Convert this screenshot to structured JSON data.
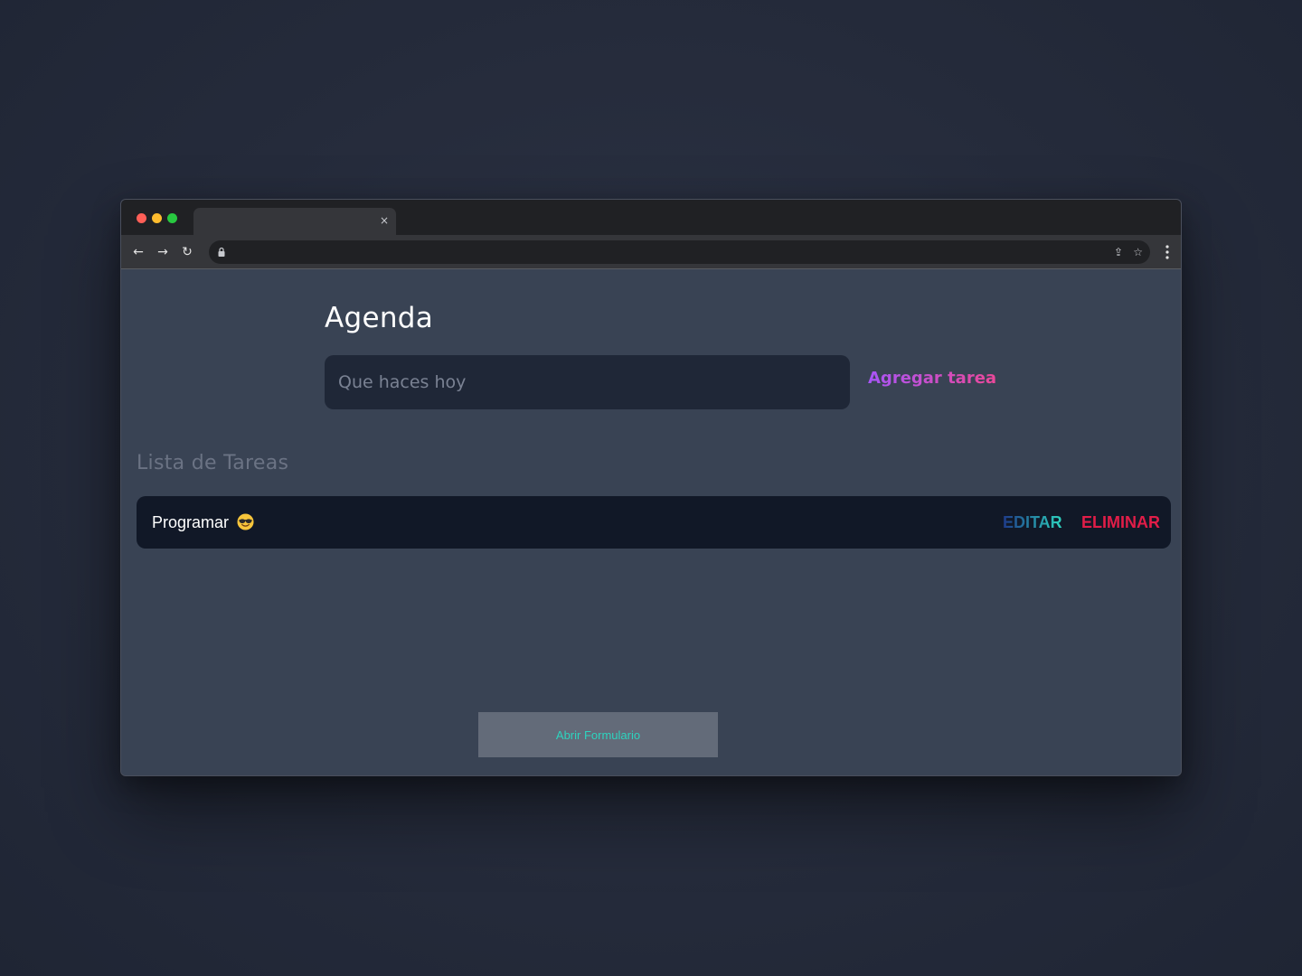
{
  "browser": {
    "tab": {
      "title": "",
      "close_glyph": "×"
    },
    "toolbar": {
      "back_icon": "←",
      "forward_icon": "→",
      "reload_icon": "↻",
      "url": "",
      "share_icon": "⇪",
      "bookmark_icon": "☆"
    }
  },
  "app": {
    "title": "Agenda",
    "input": {
      "placeholder": "Que haces hoy",
      "value": ""
    },
    "add_button": "Agregar tarea",
    "list_title": "Lista de Tareas",
    "tasks": [
      {
        "text": "Programar",
        "emoji": "smiling-face-with-sunglasses",
        "edit_label": "EDITAR",
        "delete_label": "ELIMINAR"
      }
    ],
    "open_form_button": "Abrir Formulario"
  },
  "colors": {
    "page_background": "#394354",
    "input_background": "#1f2737",
    "task_background": "#111827",
    "add_gradient": [
      "#a855f7",
      "#ec4899"
    ],
    "edit_gradient": [
      "#1e3a8a",
      "#2dd4bf"
    ],
    "delete": "#e11d48",
    "open_form_text": "#2dd4bf",
    "open_form_background": "#636b79"
  }
}
